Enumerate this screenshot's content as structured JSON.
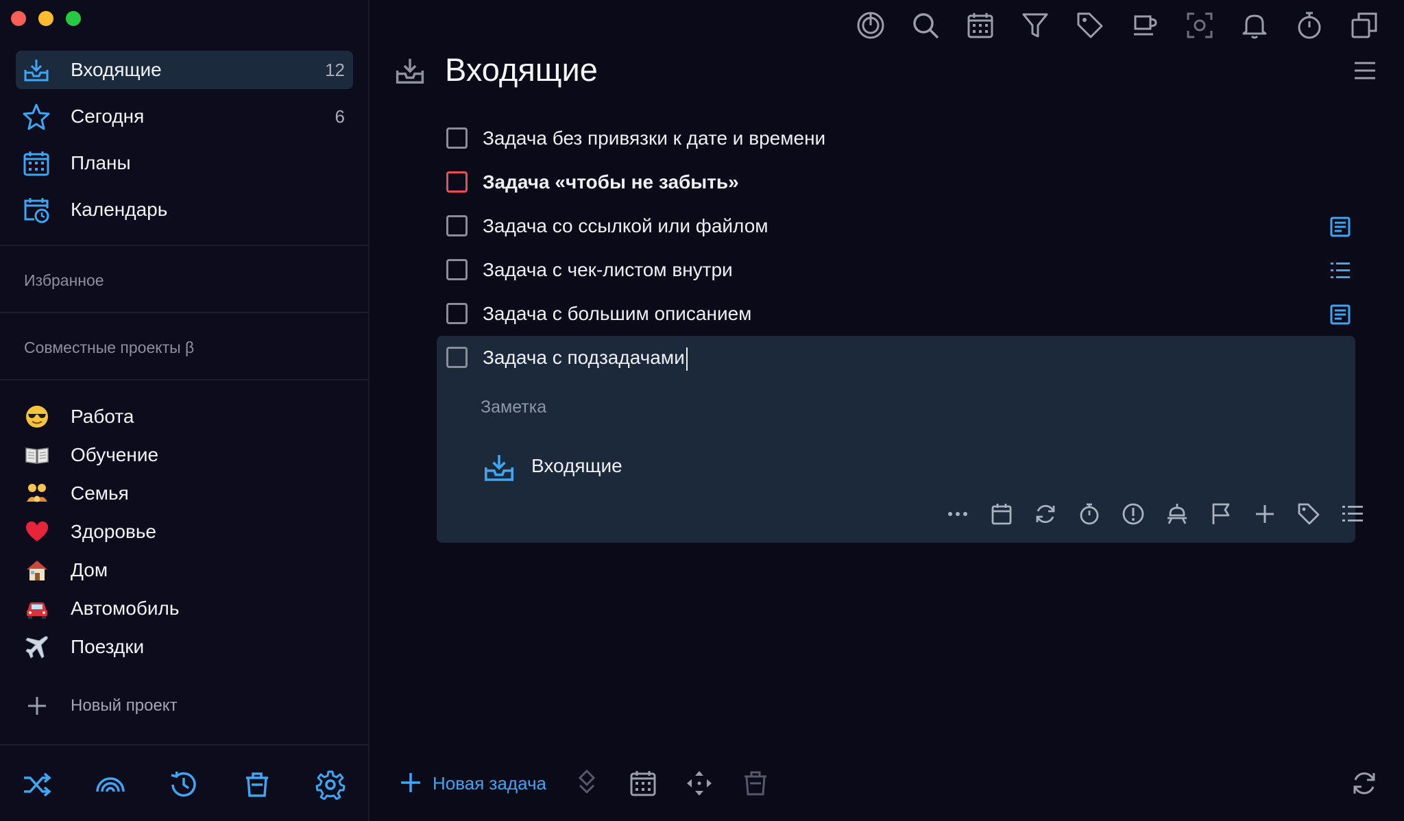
{
  "sidebar": {
    "nav": [
      {
        "label": "Входящие",
        "count": "12",
        "icon": "inbox-icon"
      },
      {
        "label": "Сегодня",
        "count": "6",
        "icon": "star-icon"
      },
      {
        "label": "Планы",
        "count": "",
        "icon": "calendar-grid-icon"
      },
      {
        "label": "Календарь",
        "count": "",
        "icon": "calendar-clock-icon"
      }
    ],
    "favorites_label": "Избранное",
    "shared_label": "Совместные проекты β",
    "projects": [
      {
        "label": "Работа",
        "icon": "sunglasses-emoji-icon"
      },
      {
        "label": "Обучение",
        "icon": "book-emoji-icon"
      },
      {
        "label": "Семья",
        "icon": "family-emoji-icon"
      },
      {
        "label": "Здоровье",
        "icon": "heart-emoji-icon"
      },
      {
        "label": "Дом",
        "icon": "house-emoji-icon"
      },
      {
        "label": "Автомобиль",
        "icon": "car-emoji-icon"
      },
      {
        "label": "Поездки",
        "icon": "airplane-emoji-icon"
      }
    ],
    "new_project_label": "Новый проект",
    "bottom_icons": [
      "shuffle-icon",
      "rainbow-icon",
      "history-icon",
      "trash-icon",
      "gear-icon"
    ]
  },
  "toolbar": {
    "icons": [
      "focus-icon",
      "search-icon",
      "calendar-icon",
      "filter-icon",
      "tag-icon",
      "coffee-icon",
      "screenshot-icon",
      "bell-icon",
      "timer-icon",
      "windows-icon"
    ]
  },
  "main": {
    "title": "Входящие",
    "tasks": [
      {
        "label": "Задача без привязки к дате и времени",
        "bold": false,
        "priority": false,
        "side_icon": ""
      },
      {
        "label": "Задача «чтобы не забыть»",
        "bold": true,
        "priority": true,
        "side_icon": ""
      },
      {
        "label": "Задача со ссылкой или файлом",
        "bold": false,
        "priority": false,
        "side_icon": "note-icon"
      },
      {
        "label": "Задача с чек-листом внутри",
        "bold": false,
        "priority": false,
        "side_icon": "checklist-icon"
      },
      {
        "label": "Задача с большим описанием",
        "bold": false,
        "priority": false,
        "side_icon": "note-icon"
      }
    ],
    "editing_task": {
      "label": "Задача с подзадачами",
      "note_placeholder": "Заметка",
      "project": "Входящие",
      "actions": [
        "more-icon",
        "calendar-icon",
        "repeat-icon",
        "timer-icon",
        "priority-icon",
        "reminder-icon",
        "flag-icon",
        "subtask-icon",
        "tag-icon",
        "checklist-icon"
      ]
    }
  },
  "bottom_bar": {
    "new_task_label": "Новая задача",
    "icons": [
      "collapse-icon",
      "calendar-icon",
      "move-icon",
      "trash-icon",
      "sync-icon"
    ]
  },
  "colors": {
    "accent": "#3ea7f5",
    "priority": "#e44f5d",
    "background": "#0b0a18",
    "panel": "#1c293b"
  }
}
